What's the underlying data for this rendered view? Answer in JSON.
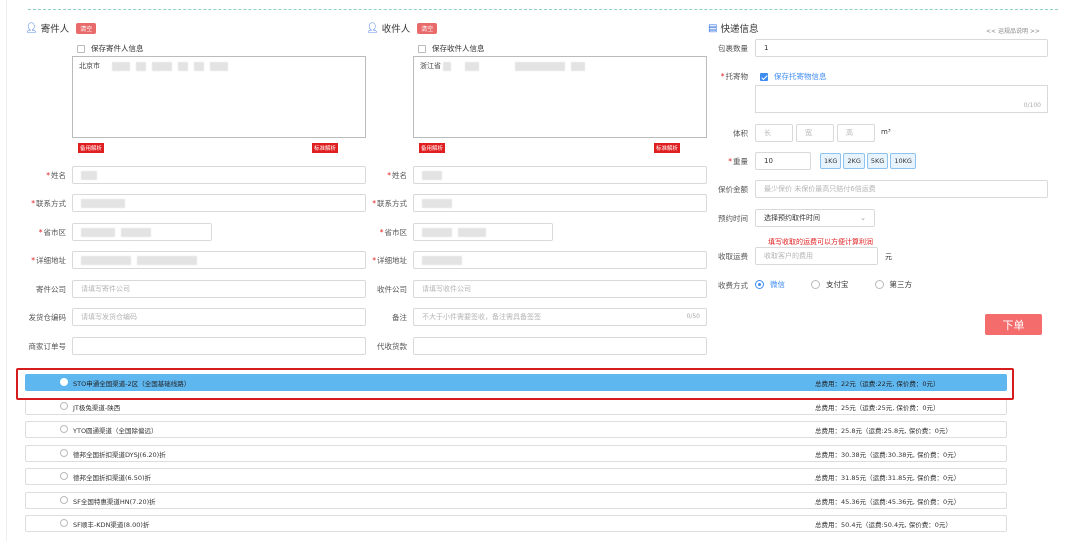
{
  "sender": {
    "title": "寄件人",
    "clear_label": "清空",
    "save_label": "保存寄件人信息",
    "address_text": "北京市",
    "parse_left": "备用解析",
    "parse_right": "标准解析",
    "fields": {
      "name_label": "姓名",
      "phone_label": "联系方式",
      "region_label": "省市区",
      "detail_label": "详细地址",
      "company_label": "寄件公司",
      "company_placeholder": "请填写寄件公司",
      "warehouse_label": "发货仓编码",
      "warehouse_placeholder": "请填写发货仓编码",
      "order_no_label": "商家订单号"
    }
  },
  "receiver": {
    "title": "收件人",
    "clear_label": "清空",
    "save_label": "保存收件人信息",
    "address_text": "浙江省",
    "parse_left": "备用解析",
    "parse_right": "标准解析",
    "fields": {
      "name_label": "姓名",
      "phone_label": "联系方式",
      "region_label": "省市区",
      "detail_label": "详细地址",
      "company_label": "收件公司",
      "company_placeholder": "请填写收件公司",
      "remark_label": "备注",
      "remark_placeholder": "不大于小件需要签收，备注需具备签签",
      "remark_counter": "0/50",
      "cod_label": "代收货款"
    }
  },
  "express": {
    "title": "快递信息",
    "help_link": "<< 运规品说明 >>",
    "package_count_label": "包裹数量",
    "package_count_value": "1",
    "goods_label": "托寄物",
    "save_goods_label": "保存托寄物信息",
    "goods_counter": "0/100",
    "volume_label": "体积",
    "volume_length_ph": "长",
    "volume_width_ph": "宽",
    "volume_height_ph": "高",
    "volume_unit": "m³",
    "weight_label": "重量",
    "weight_value": "10",
    "weight_buttons": [
      "1KG",
      "2KG",
      "5KG",
      "10KG"
    ],
    "insured_label": "保价金额",
    "insured_placeholder": "最少保价 未保价最高只赔付6倍运费",
    "pickup_label": "预约时间",
    "pickup_value": "选择预约取件时间",
    "freight_note": "填写收取的运费可以方便计算利润",
    "freight_label": "收取运费",
    "freight_placeholder": "收取客户的费用",
    "freight_unit": "元",
    "pay_label": "收费方式",
    "pay_options": [
      "微信",
      "支付宝",
      "第三方"
    ],
    "order_button": "下单"
  },
  "channels": [
    {
      "name": "STO申通全国渠道-2区（全国基础线路）",
      "fee": "总费用：22元（运费:22元, 保价费：0元）",
      "selected": true
    },
    {
      "name": "JT极兔渠道-陕西",
      "fee": "总费用：25元（运费:25元, 保价费：0元）",
      "selected": false
    },
    {
      "name": "YTO圆通渠道（全国除偏远）",
      "fee": "总费用：25.8元（运费:25.8元, 保价费：0元）",
      "selected": false
    },
    {
      "name": "德邦全国折扣渠道DYSJ(6.20)折",
      "fee": "总费用：30.38元（运费:30.38元, 保价费：0元）",
      "selected": false
    },
    {
      "name": "德邦全国折扣渠道(6.50)折",
      "fee": "总费用：31.85元（运费:31.85元, 保价费：0元）",
      "selected": false
    },
    {
      "name": "SF全国特惠渠道HN(7.20)折",
      "fee": "总费用：45.36元（运费:45.36元, 保价费：0元）",
      "selected": false
    },
    {
      "name": "SF顺丰-KDN渠道(8.00)折",
      "fee": "总费用：50.4元（运费:50.4元, 保价费：0元）",
      "selected": false
    }
  ]
}
